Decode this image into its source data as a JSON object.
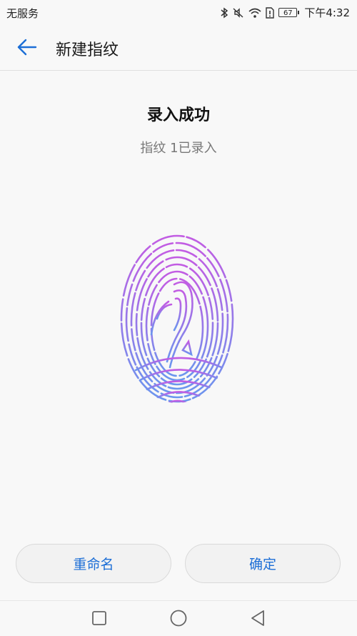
{
  "status_bar": {
    "carrier": "无服务",
    "battery": "67",
    "time": "下午4:32",
    "icons": [
      "bluetooth-icon",
      "mute-icon",
      "wifi-icon",
      "sim-alert-icon",
      "battery-icon"
    ]
  },
  "app_bar": {
    "title": "新建指纹",
    "back_icon": "arrow-left-icon"
  },
  "content": {
    "headline": "录入成功",
    "subline": "指纹 1已录入",
    "illustration": "fingerprint-icon"
  },
  "buttons": {
    "rename": "重命名",
    "confirm": "确定"
  },
  "nav_bar": {
    "icons": [
      "recents-square-icon",
      "home-circle-icon",
      "back-triangle-icon"
    ]
  },
  "colors": {
    "accent": "#1c6ed6",
    "fingerprint_top": "#c25ce3",
    "fingerprint_bottom": "#6a96ee",
    "background": "#f8f8f8"
  }
}
